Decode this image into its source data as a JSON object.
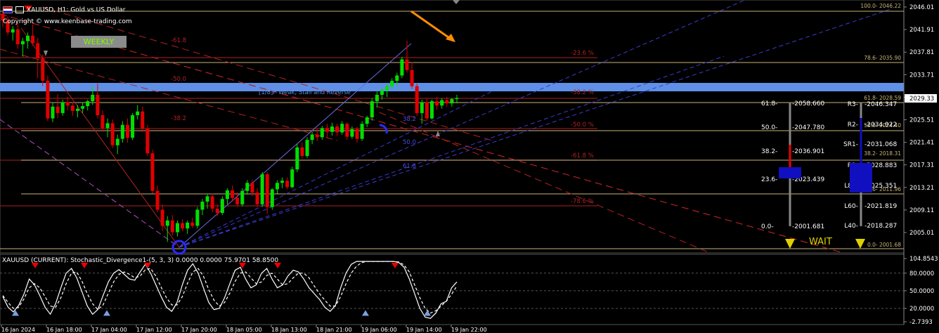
{
  "header": {
    "symbol_line": "XAUUSD, H1:  Gold vs US Dollar",
    "copyright": "Copyright © www.keenbase-trading.com",
    "timeframe_badge": "WEEKLY"
  },
  "colors": {
    "background": "#000000",
    "bull_candle": "#00e000",
    "bear_candle": "#e00000",
    "resistance_band": "#5f8fe6",
    "fib_line": "#8b1a1a",
    "level_line": "#c8b478",
    "arrow_orange": "#ff8c00"
  },
  "chart_data": [
    {
      "type": "candlestick",
      "title": "",
      "ylim": [
        2001,
        2046.01
      ],
      "price_axis_ticks": [
        "2046.01",
        "2041.91",
        "2037.81",
        "2033.71",
        "2029.61",
        "2025.51",
        "2021.41",
        "2017.31",
        "2013.21",
        "2009.11",
        "2005.01"
      ],
      "current_price": "2029.33",
      "time_axis_ticks": [
        "16 Jan 2024",
        "16 Jan 18:00",
        "17 Jan 04:00",
        "17 Jan 12:00",
        "17 Jan 20:00",
        "18 Jan 05:00",
        "18 Jan 13:00",
        "18 Jan 21:00",
        "19 Jan 06:00",
        "19 Jan 14:00",
        "19 Jan 22:00"
      ],
      "candles": [
        [
          2044.5,
          2045.5,
          2042,
          2043.2
        ],
        [
          2043.2,
          2044,
          2040.5,
          2041
        ],
        [
          2041,
          2042.2,
          2039.5,
          2041.6
        ],
        [
          2041.6,
          2042.8,
          2038,
          2038.8
        ],
        [
          2038.8,
          2040,
          2036.5,
          2039.4
        ],
        [
          2039.4,
          2041,
          2038,
          2040.4
        ],
        [
          2040.4,
          2042.5,
          2038.5,
          2039
        ],
        [
          2039,
          2040,
          2032.5,
          2036.2
        ],
        [
          2036.2,
          2037,
          2031,
          2032
        ],
        [
          2032,
          2033,
          2024.5,
          2025
        ],
        [
          2025,
          2028,
          2024.3,
          2027.2
        ],
        [
          2027.2,
          2029.5,
          2025,
          2026
        ],
        [
          2026,
          2028.5,
          2025.5,
          2028
        ],
        [
          2028,
          2029,
          2026.5,
          2027.4
        ],
        [
          2027.4,
          2028,
          2025.5,
          2026.4
        ],
        [
          2026.4,
          2027.5,
          2025.2,
          2026.8
        ],
        [
          2026.8,
          2028,
          2026,
          2027.3
        ],
        [
          2027.3,
          2028.5,
          2026.5,
          2028.2
        ],
        [
          2028.2,
          2031,
          2027.5,
          2029.4
        ],
        [
          2029.4,
          2031.5,
          2025,
          2025.6
        ],
        [
          2025.6,
          2026.5,
          2022.5,
          2023.2
        ],
        [
          2023.2,
          2025,
          2021.5,
          2024.1
        ],
        [
          2024.1,
          2024.8,
          2019.5,
          2020
        ],
        [
          2020,
          2022,
          2018.4,
          2021.2
        ],
        [
          2021.2,
          2024.5,
          2020.5,
          2023.8
        ],
        [
          2023.8,
          2025,
          2020.5,
          2021.4
        ],
        [
          2021.4,
          2026,
          2021,
          2025.6
        ],
        [
          2025.6,
          2027.5,
          2024.8,
          2026.3
        ],
        [
          2026.3,
          2027.2,
          2022.5,
          2023.1
        ],
        [
          2023.1,
          2023.8,
          2018,
          2018.5
        ],
        [
          2018.5,
          2019.2,
          2011,
          2011.5
        ],
        [
          2011.5,
          2012.5,
          2007.5,
          2008
        ],
        [
          2008,
          2009,
          2004,
          2005
        ],
        [
          2005,
          2006.8,
          2002,
          2006
        ],
        [
          2006,
          2007,
          2003.2,
          2003.8
        ],
        [
          2003.8,
          2006,
          2003,
          2005.5
        ],
        [
          2005.5,
          2006.2,
          2004,
          2004.5
        ],
        [
          2004.5,
          2006,
          2003.5,
          2005.6
        ],
        [
          2005.6,
          2006.5,
          2004.6,
          2005
        ],
        [
          2005,
          2008.5,
          2004.5,
          2008
        ],
        [
          2008,
          2010,
          2007,
          2009.5
        ],
        [
          2009.5,
          2011,
          2008.2,
          2010.5
        ],
        [
          2010.5,
          2011,
          2007.5,
          2008.2
        ],
        [
          2008.2,
          2009,
          2006.8,
          2007.4
        ],
        [
          2007.4,
          2010.5,
          2007,
          2010
        ],
        [
          2010,
          2012,
          2009,
          2011.6
        ],
        [
          2011.6,
          2012.5,
          2009.5,
          2010.2
        ],
        [
          2010.2,
          2011.3,
          2008.5,
          2009
        ],
        [
          2009,
          2012,
          2008.6,
          2011.5
        ],
        [
          2011.5,
          2013.5,
          2010.8,
          2013
        ],
        [
          2013,
          2013.6,
          2010.5,
          2011.2
        ],
        [
          2011.2,
          2012,
          2008.5,
          2009
        ],
        [
          2009,
          2015,
          2008.5,
          2014.6
        ],
        [
          2014.6,
          2015,
          2007.2,
          2008.5
        ],
        [
          2008.5,
          2012,
          2008,
          2011.8
        ],
        [
          2011.8,
          2013.5,
          2011,
          2013
        ],
        [
          2013,
          2014,
          2012,
          2013.4
        ],
        [
          2013.4,
          2014,
          2011.8,
          2012.2
        ],
        [
          2012.2,
          2016,
          2012,
          2015.5
        ],
        [
          2015.5,
          2020.2,
          2015,
          2019.6
        ],
        [
          2019.6,
          2020.5,
          2017.5,
          2018
        ],
        [
          2018,
          2021.5,
          2017.6,
          2021
        ],
        [
          2021,
          2022.5,
          2020.2,
          2022
        ],
        [
          2022,
          2023,
          2020.8,
          2021.5
        ],
        [
          2021.5,
          2023.6,
          2021,
          2023.2
        ],
        [
          2023.2,
          2024,
          2021.5,
          2022.5
        ],
        [
          2022.5,
          2024.2,
          2021.8,
          2023.5
        ],
        [
          2023.5,
          2024,
          2021.8,
          2022.4
        ],
        [
          2022.4,
          2024.5,
          2022,
          2024
        ],
        [
          2024,
          2024.3,
          2021,
          2021.6
        ],
        [
          2021.6,
          2023.5,
          2021.2,
          2023
        ],
        [
          2023,
          2023.4,
          2020.5,
          2021.2
        ],
        [
          2021.2,
          2024.5,
          2020.8,
          2024
        ],
        [
          2024,
          2025.5,
          2023.4,
          2025.2
        ],
        [
          2025.2,
          2028.8,
          2024.6,
          2028.2
        ],
        [
          2028.2,
          2030,
          2027,
          2029.4
        ],
        [
          2029.4,
          2030.8,
          2028.5,
          2030.2
        ],
        [
          2030.2,
          2031.5,
          2029,
          2031
        ],
        [
          2031,
          2032.5,
          2030.5,
          2032
        ],
        [
          2032,
          2033.5,
          2031,
          2033
        ],
        [
          2033,
          2036.5,
          2032.5,
          2036
        ],
        [
          2036,
          2039.5,
          2033.5,
          2034
        ],
        [
          2034,
          2035.5,
          2030.5,
          2031
        ],
        [
          2031,
          2031.5,
          2025.5,
          2026
        ],
        [
          2026,
          2028.5,
          2024,
          2028
        ],
        [
          2028,
          2028.8,
          2024.6,
          2025
        ],
        [
          2025,
          2028.5,
          2024.8,
          2028.2
        ],
        [
          2028.2,
          2029,
          2026.6,
          2027.4
        ],
        [
          2027.4,
          2028.8,
          2026.8,
          2028.4
        ],
        [
          2028.4,
          2029,
          2027.2,
          2027.8
        ],
        [
          2027.8,
          2028.8,
          2027.2,
          2028.6
        ],
        [
          2028.6,
          2029.4,
          2027.8,
          2028.8
        ]
      ],
      "annotations": [
        {
          "text": "-61.8"
        },
        {
          "text": "-50.0"
        },
        {
          "text": "-38.2"
        },
        {
          "text": "-23.6 %"
        },
        {
          "text": "-38.2 %"
        },
        {
          "text": "-50.0 %"
        },
        {
          "text": "-61.8 %"
        },
        {
          "text": "-78.6 %"
        },
        {
          "text": "50.0"
        },
        {
          "text": "61.8"
        },
        {
          "text": "38.2"
        },
        {
          "text": "[1/8]P Weak, Stall and Reverse"
        }
      ],
      "fib_axis_labels": [
        {
          "text": "100.0- 2046.22"
        },
        {
          "text": "78.6- 2035.90"
        },
        {
          "text": "61.8- 2028.59"
        },
        {
          "text": "50.0- 2024.40"
        },
        {
          "text": "38.2- 2018.31"
        },
        {
          "text": "23.6- 2011.96"
        },
        {
          "text": "0.0- 2001.68"
        }
      ]
    },
    {
      "type": "line",
      "title": "XAUUSD (CURRENT): Stochastic_Divergence1-(5, 3, 3) 0.0000 0.0000 75.9701 58.8500",
      "ylim": [
        -2.7393,
        104.8543
      ],
      "y_ticks": [
        "104.8543",
        "80.0000",
        "50.0000",
        "20.0000",
        "-2.7393"
      ],
      "series": [
        {
          "values": [
            40,
            22,
            14,
            25,
            44,
            70,
            60,
            42,
            22,
            10,
            28,
            55,
            80,
            88,
            72,
            48,
            24,
            10,
            18,
            42,
            65,
            80,
            86,
            78,
            70,
            68,
            82,
            95,
            80,
            60,
            40,
            22,
            15,
            30,
            60,
            85,
            96,
            80,
            55,
            30,
            18,
            20,
            38,
            62,
            85,
            90,
            70,
            55,
            60,
            80,
            88,
            70,
            55,
            60,
            75,
            85,
            82,
            70,
            55,
            45,
            35,
            22,
            15,
            25,
            55,
            80,
            95,
            100,
            100,
            100,
            100,
            100,
            100,
            100,
            100,
            98,
            90,
            70,
            45,
            20,
            5,
            3,
            12,
            28,
            32,
            55,
            65
          ]
        },
        {
          "values": [
            42,
            30,
            20,
            22,
            36,
            55,
            62,
            55,
            40,
            24,
            22,
            38,
            62,
            80,
            82,
            66,
            45,
            28,
            18,
            26,
            46,
            65,
            78,
            82,
            78,
            72,
            75,
            86,
            88,
            75,
            56,
            38,
            26,
            26,
            40,
            63,
            82,
            88,
            75,
            52,
            34,
            24,
            30,
            46,
            66,
            80,
            82,
            72,
            62,
            65,
            76,
            80,
            70,
            60,
            62,
            72,
            80,
            80,
            72,
            58,
            45,
            34,
            24,
            24,
            40,
            62,
            80,
            92,
            98,
            100,
            100,
            100,
            100,
            100,
            100,
            99,
            94,
            82,
            60,
            38,
            20,
            12,
            16,
            24,
            32,
            44,
            58
          ]
        }
      ]
    }
  ],
  "pivot_panel_left": {
    "labels": [
      "61.8-",
      "50.0-",
      "38.2-",
      "23.6-",
      "0.0-"
    ],
    "values": [
      "-2058.660",
      "-2047.780",
      "-2036.901",
      "-2023.439",
      "-2001.681"
    ]
  },
  "pivot_panel_right": {
    "labels": [
      "R3-",
      "R2-",
      "SR1-",
      "R1-",
      "L80-",
      "L60-",
      "L40-"
    ],
    "values": [
      "-2046.347",
      "-2034.922",
      "-2031.068",
      "-2028.883",
      "-2025.351",
      "-2021.819",
      "-2018.287"
    ]
  },
  "signal": "WAIT"
}
